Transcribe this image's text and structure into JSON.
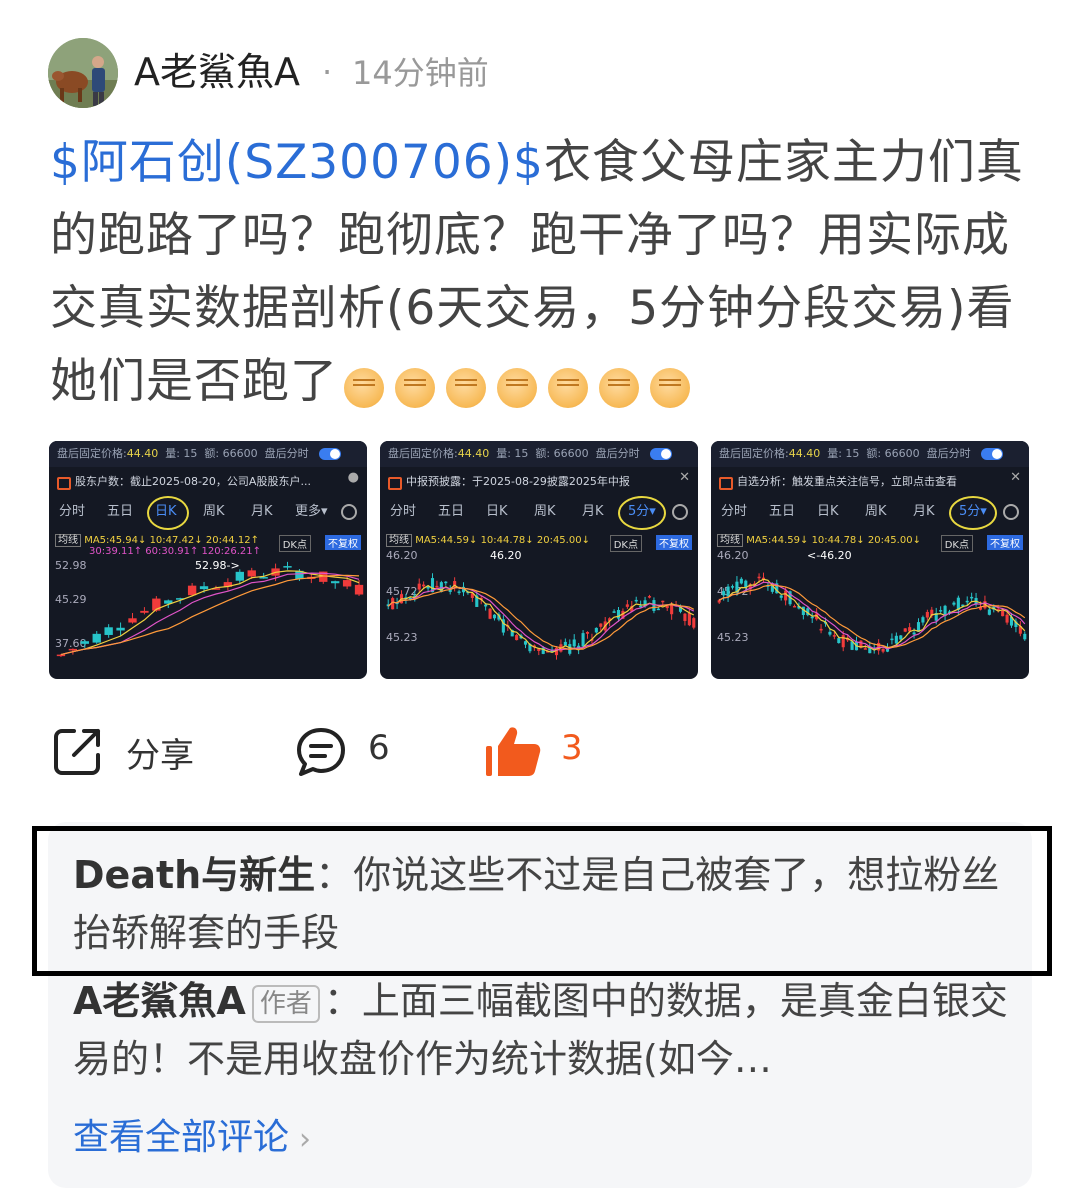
{
  "author": {
    "name": "A老鯊魚A",
    "separator": "·",
    "time": "14分钟前"
  },
  "post": {
    "stock_tag": "$阿石创(SZ300706)$",
    "text": "衣食父母庄家主力们真的跑路了吗？跑彻底？跑干净了吗？用实际成交真实数据剖析(6天交易，5分钟分段交易)看她们是否跑了",
    "emoji_icon": "raised-fist-icon",
    "emoji_count": 7
  },
  "thumbnails": [
    {
      "header": {
        "price_label": "盘后固定价格:",
        "price": "44.40",
        "vol_label": "量: 15",
        "amount": "额: 66600",
        "after_hours": "盘后分时"
      },
      "notice": "股东户数：截止2025-08-20，公司A股股东户...",
      "tabs": [
        "分时",
        "五日",
        "日K",
        "周K",
        "月K",
        "更多▾"
      ],
      "selected_tab": "日K",
      "ma_line1": "MA5:45.94↓ 10:47.42↓ 20:44.12↑",
      "ma_line2": "30:39.11↑ 60:30.91↑ 120:26.21↑",
      "avg_label": "均线",
      "dk": "DK点",
      "fq": "不复权",
      "levels": [
        "52.98",
        "45.29",
        "37.60"
      ],
      "marker": "52.98->"
    },
    {
      "header": {
        "price_label": "盘后固定价格:",
        "price": "44.40",
        "vol_label": "量: 15",
        "amount": "额: 66600",
        "after_hours": "盘后分时"
      },
      "notice": "中报预披露：于2025-08-29披露2025年中报",
      "tabs": [
        "分时",
        "五日",
        "日K",
        "周K",
        "月K",
        "5分▾"
      ],
      "selected_tab": "5分▾",
      "ma_line1": "MA5:44.59↓ 10:44.78↓ 20:45.00↓",
      "avg_label": "均线",
      "dk": "DK点",
      "fq": "不复权",
      "levels": [
        "46.20",
        "45.72",
        "45.23"
      ],
      "marker": "46.20"
    },
    {
      "header": {
        "price_label": "盘后固定价格:",
        "price": "44.40",
        "vol_label": "量: 15",
        "amount": "额: 66600",
        "after_hours": "盘后分时"
      },
      "notice": "自选分析：触发重点关注信号，立即点击查看",
      "tabs": [
        "分时",
        "五日",
        "日K",
        "周K",
        "月K",
        "5分▾"
      ],
      "selected_tab": "5分▾",
      "ma_line1": "MA5:44.59↓ 10:44.78↓ 20:45.00↓",
      "avg_label": "均线",
      "dk": "DK点",
      "fq": "不复权",
      "levels": [
        "46.20",
        "45.72",
        "45.23"
      ],
      "marker": "<-46.20"
    }
  ],
  "actions": {
    "share_label": "分享",
    "comment_count": "6",
    "like_count": "3"
  },
  "comments": [
    {
      "user": "Death与新生",
      "sep": "：",
      "text": "你说这些不过是自己被套了，想拉粉丝抬轿解套的手段"
    },
    {
      "user": "A老鯊魚A",
      "tag": "作者",
      "sep": "：",
      "text": "上面三幅截图中的数据，是真金白银交易的！不是用收盘价作为统计数据(如今…"
    }
  ],
  "view_all": {
    "label": "查看全部评论",
    "chevron": "›"
  },
  "colors": {
    "link": "#2a6dd6",
    "like": "#f25a1d",
    "rise": "#f03b3b",
    "fall": "#27c4c9"
  }
}
